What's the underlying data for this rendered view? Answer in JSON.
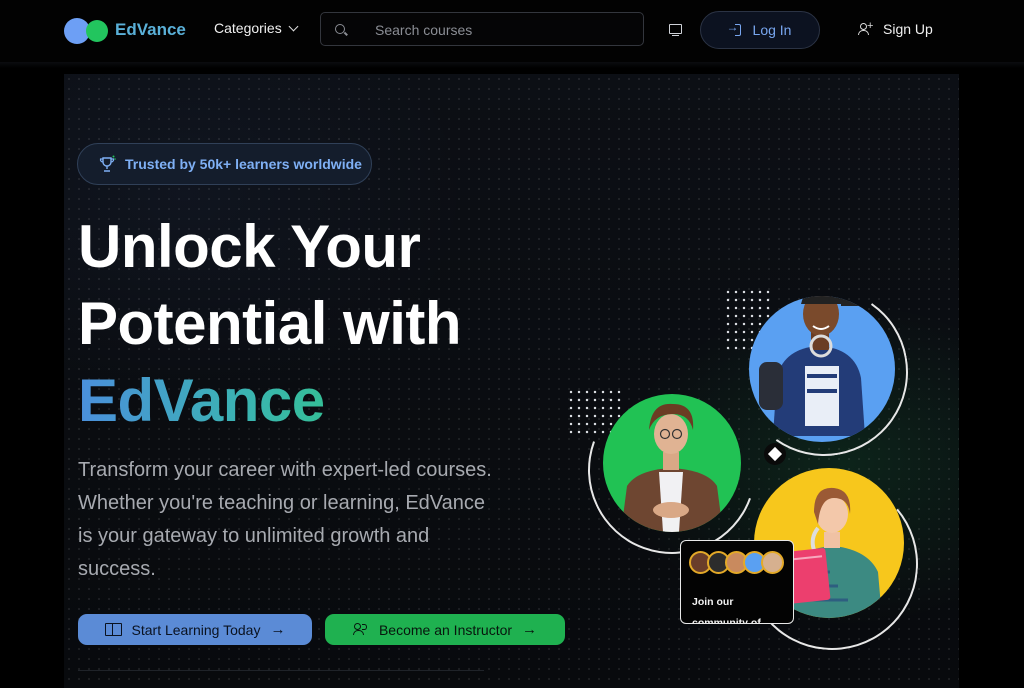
{
  "nav": {
    "brand": "EdVance",
    "categories_label": "Categories",
    "search_placeholder": "Search courses",
    "login_label": "Log In",
    "signup_label": "Sign Up"
  },
  "hero": {
    "badge": "Trusted by 50k+ learners worldwide",
    "headline_line1": "Unlock Your",
    "headline_line2": "Potential with",
    "headline_brand": "EdVance",
    "description": "Transform your career with expert-led courses. Whether you're teaching or learning, EdVance is your gateway to unlimited growth and success.",
    "primary_cta": "Start Learning Today",
    "secondary_cta": "Become an Instructor",
    "community_text": "Join our community of"
  },
  "colors": {
    "brand_blue": "#6d9ff5",
    "brand_green": "#22c55e",
    "yellow_accent": "#f7c71c"
  },
  "icons": [
    "search-icon",
    "chevron-down-icon",
    "monitor-icon",
    "login-icon",
    "user-plus-icon",
    "trophy-icon",
    "book-icon",
    "users-icon",
    "arrow-right-icon",
    "diamond-icon"
  ]
}
